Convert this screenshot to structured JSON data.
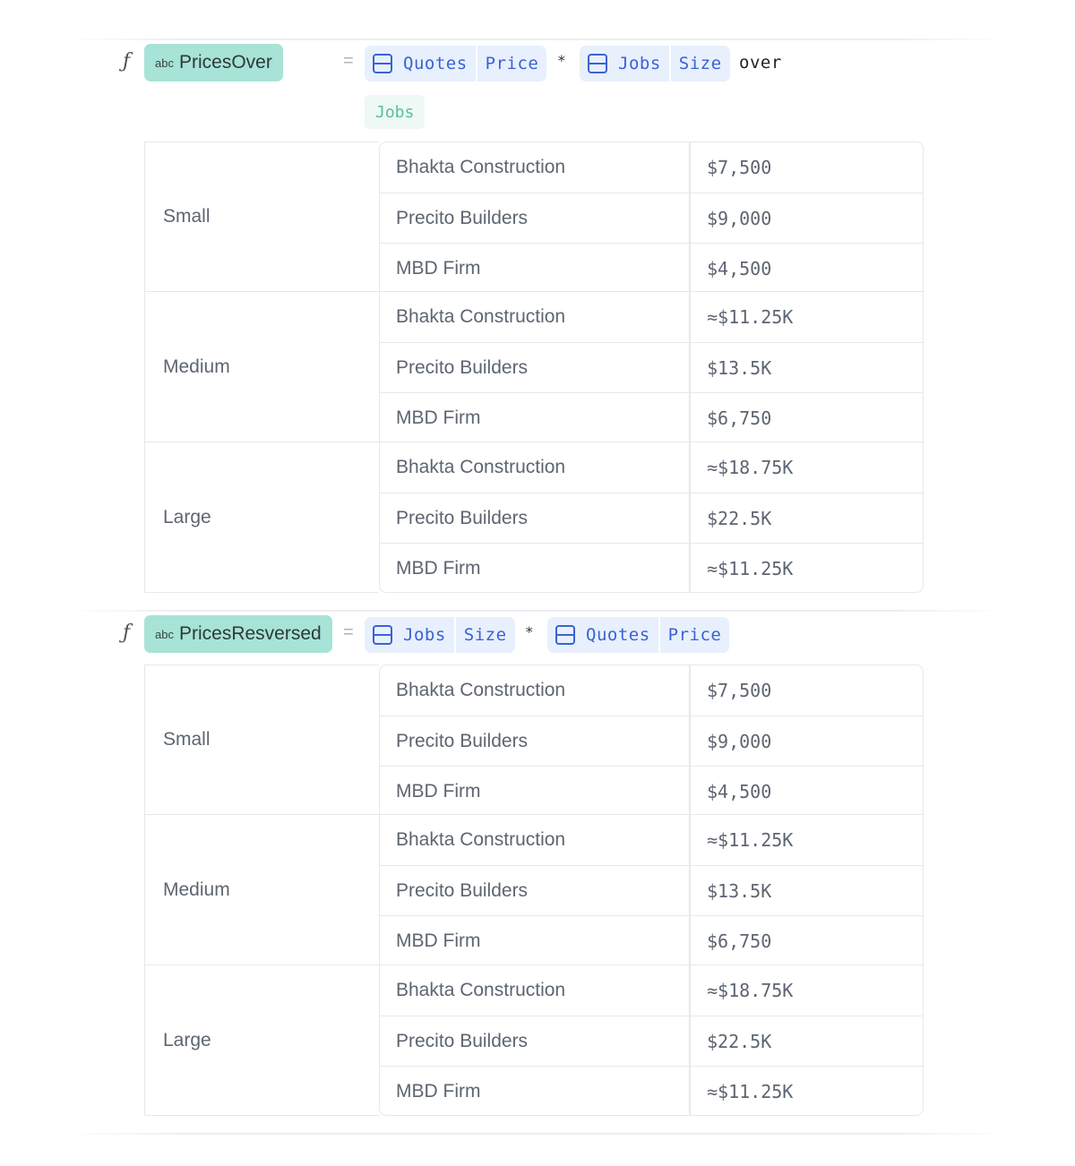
{
  "formulas": [
    {
      "name": "PricesOver",
      "type_label": "abc",
      "fx_symbol": "ƒ",
      "equals": "=",
      "operator": "*",
      "keyword": "over",
      "refs": [
        {
          "table": "Quotes",
          "column": "Price"
        },
        {
          "table": "Jobs",
          "column": "Size"
        }
      ],
      "over_table": "Jobs",
      "groups": [
        {
          "label": "Small",
          "rows": [
            {
              "name": "Bhakta Construction",
              "value": "$7,500"
            },
            {
              "name": "Precito Builders",
              "value": "$9,000"
            },
            {
              "name": "MBD Firm",
              "value": "$4,500"
            }
          ]
        },
        {
          "label": "Medium",
          "rows": [
            {
              "name": "Bhakta Construction",
              "value": "≈$11.25K"
            },
            {
              "name": "Precito Builders",
              "value": "$13.5K"
            },
            {
              "name": "MBD Firm",
              "value": "$6,750"
            }
          ]
        },
        {
          "label": "Large",
          "rows": [
            {
              "name": "Bhakta Construction",
              "value": "≈$18.75K"
            },
            {
              "name": "Precito Builders",
              "value": "$22.5K"
            },
            {
              "name": "MBD Firm",
              "value": "≈$11.25K"
            }
          ]
        }
      ]
    },
    {
      "name": "PricesResversed",
      "type_label": "abc",
      "fx_symbol": "ƒ",
      "equals": "=",
      "operator": "*",
      "refs": [
        {
          "table": "Jobs",
          "column": "Size"
        },
        {
          "table": "Quotes",
          "column": "Price"
        }
      ],
      "groups": [
        {
          "label": "Small",
          "rows": [
            {
              "name": "Bhakta Construction",
              "value": "$7,500"
            },
            {
              "name": "Precito Builders",
              "value": "$9,000"
            },
            {
              "name": "MBD Firm",
              "value": "$4,500"
            }
          ]
        },
        {
          "label": "Medium",
          "rows": [
            {
              "name": "Bhakta Construction",
              "value": "≈$11.25K"
            },
            {
              "name": "Precito Builders",
              "value": "$13.5K"
            },
            {
              "name": "MBD Firm",
              "value": "$6,750"
            }
          ]
        },
        {
          "label": "Large",
          "rows": [
            {
              "name": "Bhakta Construction",
              "value": "≈$18.75K"
            },
            {
              "name": "Precito Builders",
              "value": "$22.5K"
            },
            {
              "name": "MBD Firm",
              "value": "≈$11.25K"
            }
          ]
        }
      ]
    }
  ]
}
